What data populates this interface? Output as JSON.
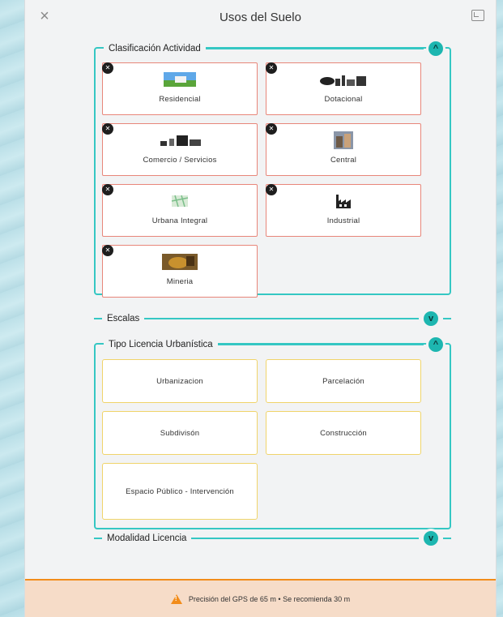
{
  "modal": {
    "title": "Usos del Suelo"
  },
  "sections": {
    "clasificacion": {
      "label": "Clasificación Actividad",
      "toggle": "^",
      "cards": [
        {
          "label": "Residencial",
          "icon": "residential-photo-icon"
        },
        {
          "label": "Dotacional",
          "icon": "buildings-icon"
        },
        {
          "label": "Comercio / Servicios",
          "icon": "shops-icon"
        },
        {
          "label": "Central",
          "icon": "central-photo-icon"
        },
        {
          "label": "Urbana Integral",
          "icon": "urban-map-icon"
        },
        {
          "label": "Industrial",
          "icon": "factory-icon"
        },
        {
          "label": "Mineria",
          "icon": "mining-photo-icon"
        }
      ]
    },
    "escalas": {
      "label": "Escalas",
      "toggle": "v"
    },
    "licencia": {
      "label": "Tipo Licencia Urbanística",
      "toggle": "^",
      "cards": [
        {
          "label": "Urbanizacion"
        },
        {
          "label": "Parcelación"
        },
        {
          "label": "Subdivisón"
        },
        {
          "label": "Construcción"
        },
        {
          "label": "Espacio Público - Intervención"
        }
      ]
    },
    "modalidad": {
      "label": "Modalidad Licencia",
      "toggle": "v"
    }
  },
  "footer": {
    "warning": "Precisión del GPS de 65 m • Se recomienda 30 m"
  },
  "colors": {
    "accent": "#35c7c3",
    "activity_card_border": "#e8867a",
    "license_card_border": "#f0d46a",
    "warning": "#f28c1a"
  }
}
